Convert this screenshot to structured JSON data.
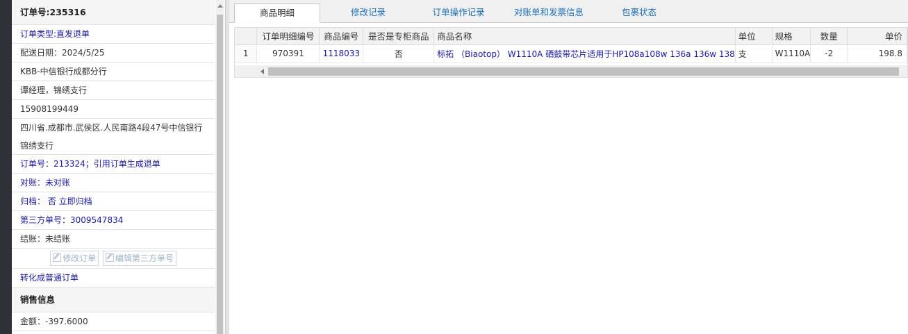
{
  "order": {
    "number_label": "订单号:",
    "number_value": "235316",
    "type_label": "订单类型:",
    "type_value": "直发退单",
    "delivery_date": "配送日期：2024/5/25",
    "customer": "KBB-中信银行成都分行",
    "contact": "谭经理，锦绣支行",
    "phone": "15908199449",
    "address": "四川省.成都市.武侯区.人民南路4段47号中信银行锦绣支行",
    "ref_order": "订单号：213324；引用订单生成退单",
    "reconcile": "对账：未对账",
    "archive": "归档：  否 立即归档",
    "third_party": "第三方单号：3009547834",
    "settle": "结账：未结账",
    "edit_order_btn": "修改订单",
    "edit_third_party_btn": "编辑第三方单号",
    "convert_link": "转化成普通订单"
  },
  "sales": {
    "title": "销售信息",
    "amount": "金额：-397.6000"
  },
  "tabs": [
    "商品明细",
    "修改记录",
    "订单操作记录",
    "对账单和发票信息",
    "包裹状态"
  ],
  "grid": {
    "columns": [
      "",
      "订单明细编号",
      "商品编号",
      "是否是专柜商品",
      "商品名称",
      "单位",
      "规格",
      "数量",
      "单价"
    ],
    "rows": [
      {
        "index": "1",
        "detail_id": "970391",
        "product_id": "1118033",
        "counter": "否",
        "name": "标拓 （Biaotop） W1110A 硒鼓带芯片适用于HP108a108w 136a 136w 138",
        "unit": "支",
        "spec": "W1110A",
        "qty": "-2",
        "price": "198.8"
      }
    ]
  },
  "colors": {
    "link": "#1a1aa6",
    "tab_link": "#1d6fb8"
  }
}
